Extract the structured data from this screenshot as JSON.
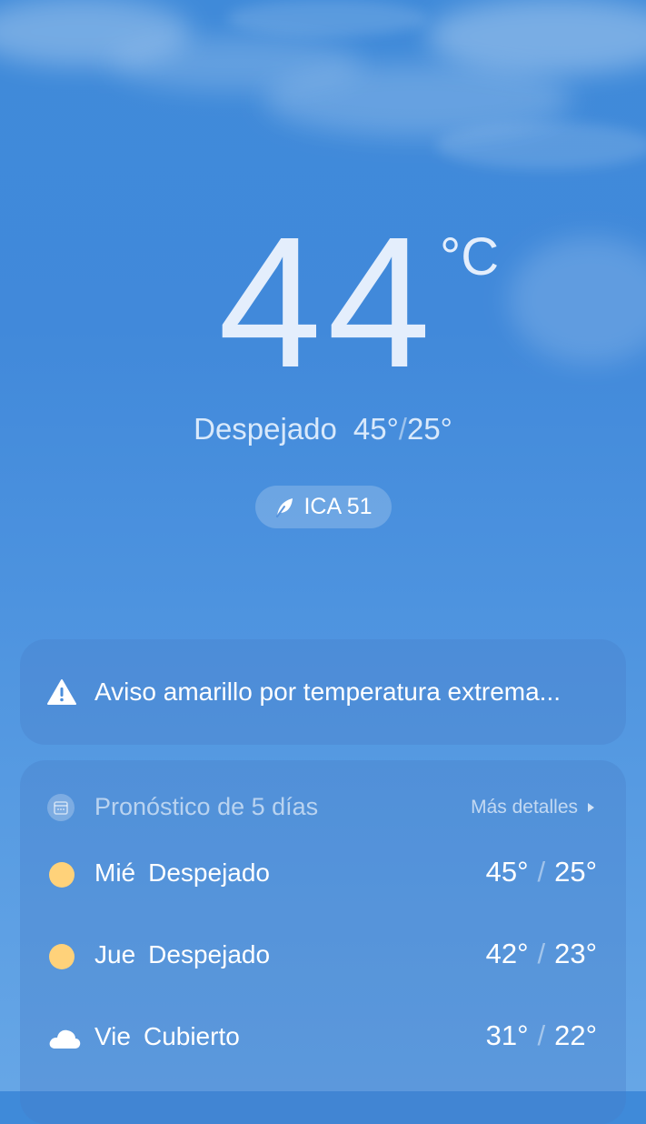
{
  "current": {
    "temperature": "44",
    "unit": "°C",
    "condition": "Despejado",
    "high": "45°",
    "low": "25°",
    "separator": "/"
  },
  "aqi": {
    "label": "ICA 51",
    "icon": "leaf-icon"
  },
  "alert": {
    "icon": "warning-icon",
    "text": "Aviso amarillo por temperatura extrema..."
  },
  "forecast": {
    "icon": "calendar-icon",
    "title": "Pronóstico de 5 días",
    "more_label": "Más detalles",
    "more_icon": "play-arrow-icon",
    "days": [
      {
        "day": "Mié",
        "condition": "Despejado",
        "icon": "sun-icon",
        "high": "45°",
        "low": "25°"
      },
      {
        "day": "Jue",
        "condition": "Despejado",
        "icon": "sun-icon",
        "high": "42°",
        "low": "23°"
      },
      {
        "day": "Vie",
        "condition": "Cubierto",
        "icon": "cloud-icon",
        "high": "31°",
        "low": "22°"
      }
    ]
  },
  "colors": {
    "sky_top": "#3f8ad9",
    "sky_bottom": "#66a6e6",
    "sun": "#ffd27a"
  }
}
